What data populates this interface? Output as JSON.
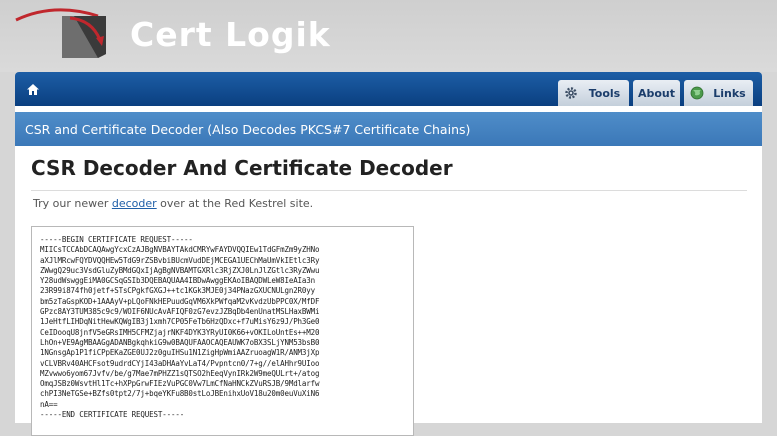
{
  "header": {
    "logo_text": "Cert Logik",
    "logo_icon": "cert-logik-logo-icon"
  },
  "navbar": {
    "home_icon": "home-icon",
    "items": [
      {
        "label": "Tools",
        "icon": "gear-icon"
      },
      {
        "label": "About"
      },
      {
        "label": "Links",
        "icon": "globe-icon"
      }
    ]
  },
  "section": {
    "heading": "CSR and Certificate Decoder (Also Decodes PKCS#7 Certificate Chains)"
  },
  "main": {
    "title": "CSR Decoder And Certificate Decoder",
    "intro_before": "Try our newer ",
    "intro_link": "decoder",
    "intro_after": " over at the Red Kestrel site."
  },
  "csr_textarea": {
    "value": "-----BEGIN CERTIFICATE REQUEST-----\nMIICsTCCAbDCAQAwgYcxCzAJBgNVBAYTAkdCMRYwFAYDVQQIEw1TdGFmZm9yZHNo\naXJlMRcwFQYDVQQHEw5TdG9rZSBvbiBUcmVudDEjMCEGA1UEChMaUmVkIEtlc3Ry\nZWwgQ29uc3VsdGluZyBMdGQxIjAgBgNVBAMTGXRlc3RjZXJ0LnJlZGtlc3RyZWwu\nY28udWswggEiMA0GCSqGSIb3DQEBAQUAA4IBDwAwggEKAoIBAQDWLeW8IeAIa3n\n23R99i874fh0jetf+STsCPgkfGXGJ++tc1KGk3MJE0j34PNazGXUCNULgn2R0yy\nbm5zTaGspKOD+1AAAyV+pLQoFNkHEPuudGqVM6XkPWfqaM2vKvdzUbPPC0X/MfDF\nGPzc8AY3TUM385c9c9/WOIF6NUcAvAFIQF0zG7evzJZBqDb4enUnatMSLHaxBWMi\n1JeHtfLIHDqNitHewKQWgIB3j1xmh7CP05FeTb6HzQDxc+f7uMisY6z9J/Ph3Ge0\nCeIDooqU8jnfV5eGRsIMH5CFMZjajrNKF4DYK3YRyUI0K66+vOKILoUntEs++M20\nLhOn+VE9AgMBAAGgADANBgkqhkiG9w0BAQUFAAOCAQEAUWK7oBX3SLjYNM53bsB0\n1NGnsgAp1P1fiCPpEKaZGE0UJ2z0guIHSu1N1ZigHpWmiAAZruoagW1R/ANM3jXp\nvCLVBRv40AHCFsot9udrdCYjI43aDHAaYvLaT4/Pvpntcn0/7+g//elAHhr9UIoo\nMZvwwo6yom67Jvfv/be/g7Mae7mPHZZ1sQTSO2hEeqVynIRk2W9meQULrt+/atog\nOmqJSBz0WsvtHl1Tc+hXPpGrwFIEzVuPGC0Vw7LmCfNaHNCkZVuRSJB/9Mdlarfw\nchPI3NeTGSe+BZfs0tpt2/7j+bqeYKFu8B0stLoJBEnihxUoV18u20m0euVuXiN6\nnA==\n-----END CERTIFICATE REQUEST-----"
  },
  "colors": {
    "navbar": "#0a3f80",
    "section_bar": "#3b78b8",
    "link": "#1f5fa8",
    "logo_red": "#c0272d"
  }
}
